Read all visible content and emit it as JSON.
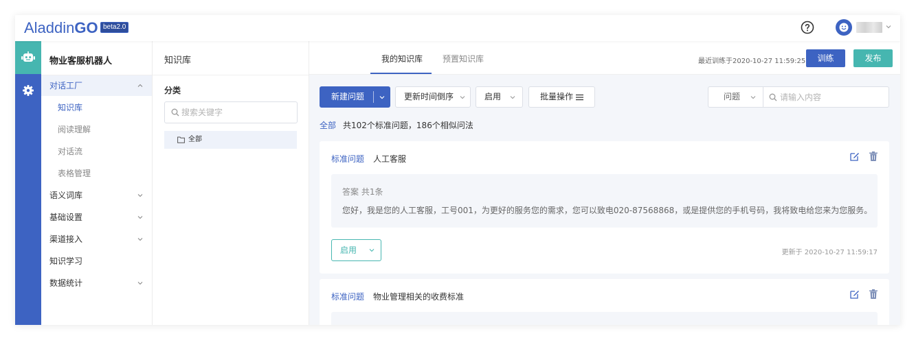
{
  "header": {
    "logo_text": "Aladdin",
    "logo_go": "GO",
    "beta_badge": "beta2.0",
    "help_icon": "question-circle-icon",
    "avatar_icon": "smiley-avatar-icon",
    "user_menu_icon": "chevron-down-icon"
  },
  "rail": [
    {
      "icon": "robot-icon",
      "active": true
    },
    {
      "icon": "gear-icon",
      "active": false
    }
  ],
  "nav": {
    "title": "物业客服机器人",
    "items": [
      {
        "label": "对话工厂",
        "expanded": true
      },
      {
        "label": "知识库"
      },
      {
        "label": "阅读理解"
      },
      {
        "label": "对话流"
      },
      {
        "label": "表格管理"
      },
      {
        "label": "语义词库"
      },
      {
        "label": "基础设置"
      },
      {
        "label": "渠道接入"
      },
      {
        "label": "知识学习"
      },
      {
        "label": "数据统计"
      }
    ]
  },
  "category": {
    "breadcrumb": "知识库",
    "heading": "分类",
    "search_placeholder": "搜索关键字",
    "tree_all": "全部"
  },
  "main": {
    "tabs": [
      {
        "label": "我的知识库",
        "active": true
      },
      {
        "label": "预置知识库",
        "active": false
      }
    ],
    "last_train": "最近训练于2020-10-27 11:59:25",
    "train_label": "训练",
    "publish_label": "发布",
    "toolbar": {
      "new_label": "新建问题",
      "sort_label": "更新时间倒序",
      "status_label": "启用",
      "batch_label": "批量操作",
      "filter_type": "问题",
      "filter_placeholder": "请输入内容"
    },
    "summary_all": "全部",
    "summary_text": "共102个标准问题，186个相似问法"
  },
  "cards": [
    {
      "q_label": "标准问题",
      "question": "人工客服",
      "answer_head": "答案 共1条",
      "answer_body": "您好，我是您的人工客服，工号001，为更好的服务您的需求，您可以致电020-87568868，或是提供您的手机号码，我将致电给您来为您服务。",
      "status": "启用",
      "updated": "更新于 2020-10-27 11:59:17"
    },
    {
      "q_label": "标准问题",
      "question": "物业管理相关的收费标准"
    }
  ],
  "colors": {
    "primary": "#3d63c2",
    "teal": "#46b6b0",
    "page_bg": "#f4f6fa"
  }
}
